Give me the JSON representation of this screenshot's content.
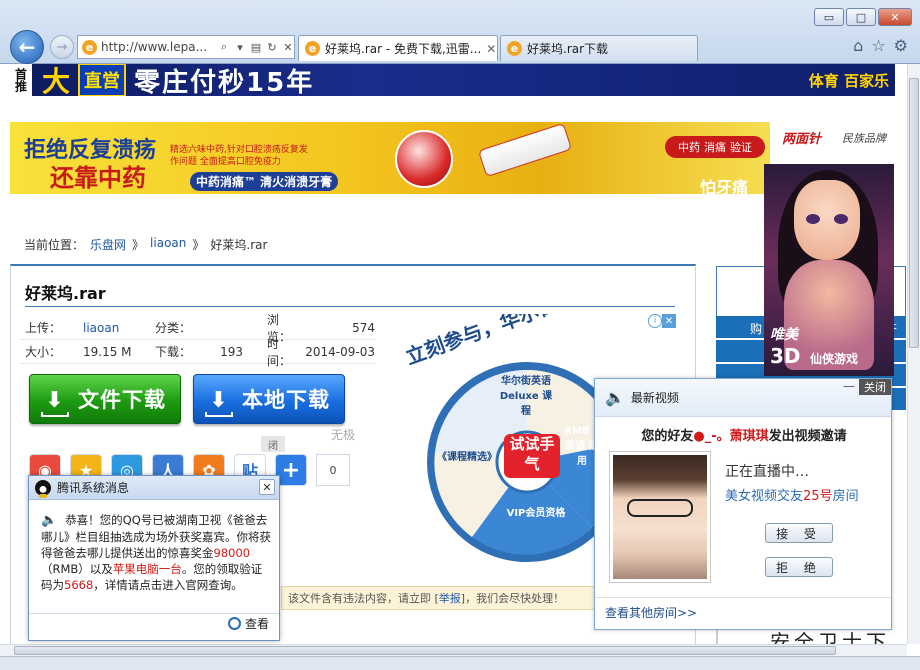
{
  "browser": {
    "window_controls": {
      "minimize": "▭",
      "maximize": "□",
      "close": "✕"
    },
    "address": "http://www.lepa...",
    "tabs": [
      {
        "label": "好莱坞.rar - 免费下载,迅雷...",
        "active": true
      },
      {
        "label": "好莱坞.rar下载",
        "active": false
      }
    ],
    "tool_icons": [
      "home-icon",
      "star-icon",
      "gear-icon"
    ]
  },
  "banners": {
    "top": {
      "tag": "首推",
      "slogan1": "大",
      "badge": "直営",
      "slogan2": "零庄付秒15年",
      "right": "体育 百家乐"
    },
    "toothpaste": {
      "line1": "拒绝反复溃疡",
      "line2": "还靠中药",
      "detail": "精选六味中药,针对口腔溃疡反复发作问题 全面提高口腔免疫力",
      "pill": "中药消痛™ 清火消溃牙膏",
      "badge_left": "中药",
      "badge_mid": "消痛",
      "badge_right": "验证",
      "slogan": "怕牙痛",
      "brand": "两面针",
      "brand2": "民族品牌"
    }
  },
  "breadcrumb": {
    "prefix": "当前位置：",
    "items": [
      "乐盘网",
      "liaoan",
      "好莱坞.rar"
    ],
    "separator": "》"
  },
  "file": {
    "title": "好莱坞.rar",
    "uploader_label": "上传：",
    "uploader": "liaoan",
    "category_label": "分类：",
    "category": "",
    "views_label": "浏览：",
    "views": "574",
    "size_label": "大小：",
    "size": "19.15 M",
    "downloads_label": "下载：",
    "downloads": "193",
    "time_label": "时间：",
    "time": "2014-09-03"
  },
  "buttons": {
    "file_download": "文件下载",
    "local_download": "本地下载",
    "wuji": "无极",
    "closed": "闭"
  },
  "share": {
    "count": "0"
  },
  "report": {
    "text_before": "该文件含有违法内容，请立即 [",
    "link": "举报",
    "text_after": "]，我们会尽快处理！"
  },
  "wheel_ad": {
    "headline": "立刻参与，华尔街英语为你的学",
    "center": "试试手气",
    "segments": [
      "华尔街英语 Deluxe 课程",
      "RMB 5 英语 抵用",
      "VIP会员资格",
      "《课程精选》"
    ],
    "info": "i",
    "close": "✕"
  },
  "side": {
    "strip_text": "购",
    "strip_text_right": "齐",
    "bottom": "安全卫士下载"
  },
  "game_ad": {
    "t1": "唯美",
    "t2": "3D",
    "t3": "仙侠游戏"
  },
  "video_popup": {
    "title": "最新视频",
    "minimize": "—",
    "close": "关闭",
    "invite_before": "您的好友",
    "invite_name": "●_-。萧琪琪",
    "invite_after": "发出视频邀请",
    "live": "正在直播中…",
    "room_before": "美女视频交友",
    "room_num": "25号",
    "room_after": "房间",
    "accept": "接 受",
    "reject": "拒 绝",
    "footer": "查看其他房间>>"
  },
  "qq_popup": {
    "title": "腾讯系统消息",
    "close": "✕",
    "line_1": "恭喜！您的QQ号已被湖南卫视《爸爸去哪儿》栏目组抽选成为场外获奖嘉宾。你将获得爸爸去哪儿提供送出的惊喜奖金",
    "amount": "98000",
    "rmb": "（RMB）以及",
    "prize": "苹果电脑一台",
    "line_2": "。您的领取验证码为",
    "code": "5668",
    "line_3": "，详情请点击进入官网查询。",
    "view": "查看"
  }
}
